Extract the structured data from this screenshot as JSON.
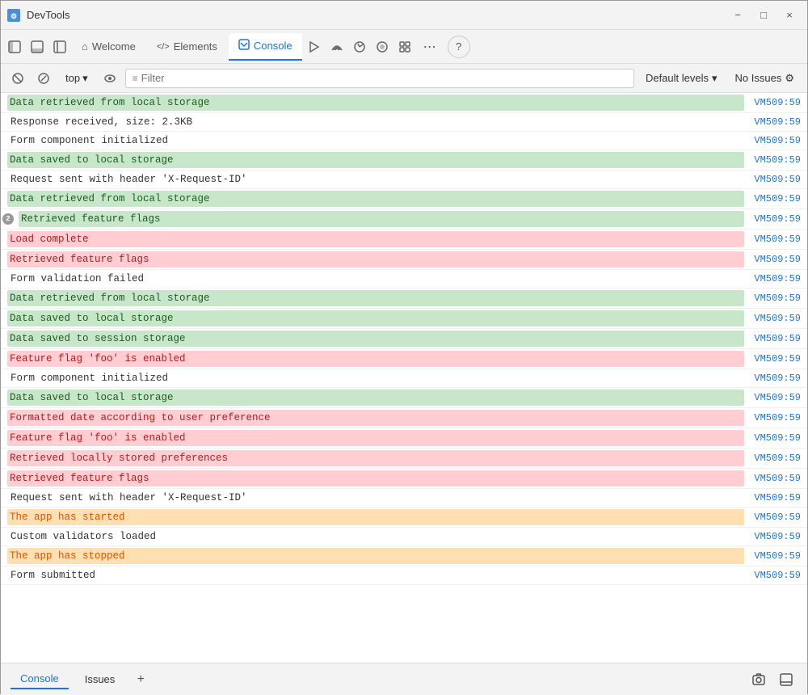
{
  "titleBar": {
    "icon": "⚙",
    "title": "DevTools",
    "minimizeLabel": "−",
    "maximizeLabel": "□",
    "closeLabel": "×"
  },
  "tabs": [
    {
      "id": "dock-left",
      "label": "",
      "icon": "⊣",
      "type": "icon-only"
    },
    {
      "id": "dock-bottom",
      "label": "",
      "icon": "⊥",
      "type": "icon-only"
    },
    {
      "id": "sidebar",
      "label": "",
      "icon": "▥",
      "type": "icon-only"
    },
    {
      "id": "welcome",
      "label": "Welcome",
      "icon": "⌂"
    },
    {
      "id": "elements",
      "label": "Elements",
      "icon": "</>"
    },
    {
      "id": "console",
      "label": "Console",
      "icon": "▸",
      "active": true
    },
    {
      "id": "sources",
      "label": "",
      "icon": "⚡",
      "type": "icon-only"
    },
    {
      "id": "network",
      "label": "",
      "icon": "📶",
      "type": "icon-only"
    },
    {
      "id": "performance",
      "label": "",
      "icon": "⤢",
      "type": "icon-only"
    },
    {
      "id": "memory",
      "label": "",
      "icon": "⚙",
      "type": "icon-only"
    },
    {
      "id": "application",
      "label": "",
      "icon": "⬡",
      "type": "icon-only"
    },
    {
      "id": "more",
      "label": "...",
      "type": "more"
    },
    {
      "id": "help",
      "label": "?",
      "type": "help"
    }
  ],
  "toolbar": {
    "clearLabel": "🚫",
    "filterToggleLabel": "⊘",
    "contextValue": "top",
    "contextDropIcon": "▾",
    "eyeLabel": "👁",
    "filterPlaceholder": "Filter",
    "filterValue": "",
    "defaultLevelsLabel": "Default levels",
    "defaultLevelsDropIcon": "▾",
    "noIssuesLabel": "No Issues",
    "settingsIcon": "⚙"
  },
  "consoleLogs": [
    {
      "id": 1,
      "text": "Data retrieved from local storage",
      "highlight": "green",
      "source": "VM509:59",
      "badge": null
    },
    {
      "id": 2,
      "text": "Response received, size: 2.3KB",
      "highlight": "none",
      "source": "VM509:59",
      "badge": null
    },
    {
      "id": 3,
      "text": "Form component initialized",
      "highlight": "none",
      "source": "VM509:59",
      "badge": null
    },
    {
      "id": 4,
      "text": "Data saved to local storage",
      "highlight": "green",
      "source": "VM509:59",
      "badge": null
    },
    {
      "id": 5,
      "text": "Request sent with header 'X-Request-ID'",
      "highlight": "none",
      "source": "VM509:59",
      "badge": null
    },
    {
      "id": 6,
      "text": "Data retrieved from local storage",
      "highlight": "green",
      "source": "VM509:59",
      "badge": null
    },
    {
      "id": 7,
      "text": "Retrieved feature flags",
      "highlight": "green",
      "source": "VM509:59",
      "badge": "2"
    },
    {
      "id": 8,
      "text": "Load complete",
      "highlight": "red",
      "source": "VM509:59",
      "badge": null
    },
    {
      "id": 9,
      "text": "Retrieved feature flags",
      "highlight": "red",
      "source": "VM509:59",
      "badge": null
    },
    {
      "id": 10,
      "text": "Form validation failed",
      "highlight": "none",
      "source": "VM509:59",
      "badge": null
    },
    {
      "id": 11,
      "text": "Data retrieved from local storage",
      "highlight": "green",
      "source": "VM509:59",
      "badge": null
    },
    {
      "id": 12,
      "text": "Data saved to local storage",
      "highlight": "green",
      "source": "VM509:59",
      "badge": null
    },
    {
      "id": 13,
      "text": "Data saved to session storage",
      "highlight": "green",
      "source": "VM509:59",
      "badge": null
    },
    {
      "id": 14,
      "text": "Feature flag 'foo' is enabled",
      "highlight": "red",
      "source": "VM509:59",
      "badge": null
    },
    {
      "id": 15,
      "text": "Form component initialized",
      "highlight": "none",
      "source": "VM509:59",
      "badge": null
    },
    {
      "id": 16,
      "text": "Data saved to local storage",
      "highlight": "green",
      "source": "VM509:59",
      "badge": null
    },
    {
      "id": 17,
      "text": "Formatted date according to user preference",
      "highlight": "red",
      "source": "VM509:59",
      "badge": null
    },
    {
      "id": 18,
      "text": "Feature flag 'foo' is enabled",
      "highlight": "red",
      "source": "VM509:59",
      "badge": null
    },
    {
      "id": 19,
      "text": "Retrieved locally stored preferences",
      "highlight": "red",
      "source": "VM509:59",
      "badge": null
    },
    {
      "id": 20,
      "text": "Retrieved feature flags",
      "highlight": "red",
      "source": "VM509:59",
      "badge": null
    },
    {
      "id": 21,
      "text": "Request sent with header 'X-Request-ID'",
      "highlight": "none",
      "source": "VM509:59",
      "badge": null
    },
    {
      "id": 22,
      "text": "The app has started",
      "highlight": "orange",
      "source": "VM509:59",
      "badge": null
    },
    {
      "id": 23,
      "text": "Custom validators loaded",
      "highlight": "none",
      "source": "VM509:59",
      "badge": null
    },
    {
      "id": 24,
      "text": "The app has stopped",
      "highlight": "orange",
      "source": "VM509:59",
      "badge": null
    },
    {
      "id": 25,
      "text": "Form submitted",
      "highlight": "none",
      "source": "VM509:59",
      "badge": null
    }
  ],
  "bottomBar": {
    "consoleTab": "Console",
    "issuesTab": "Issues",
    "addIcon": "+",
    "screenshotIcon": "📷",
    "dockIcon": "⊟"
  }
}
